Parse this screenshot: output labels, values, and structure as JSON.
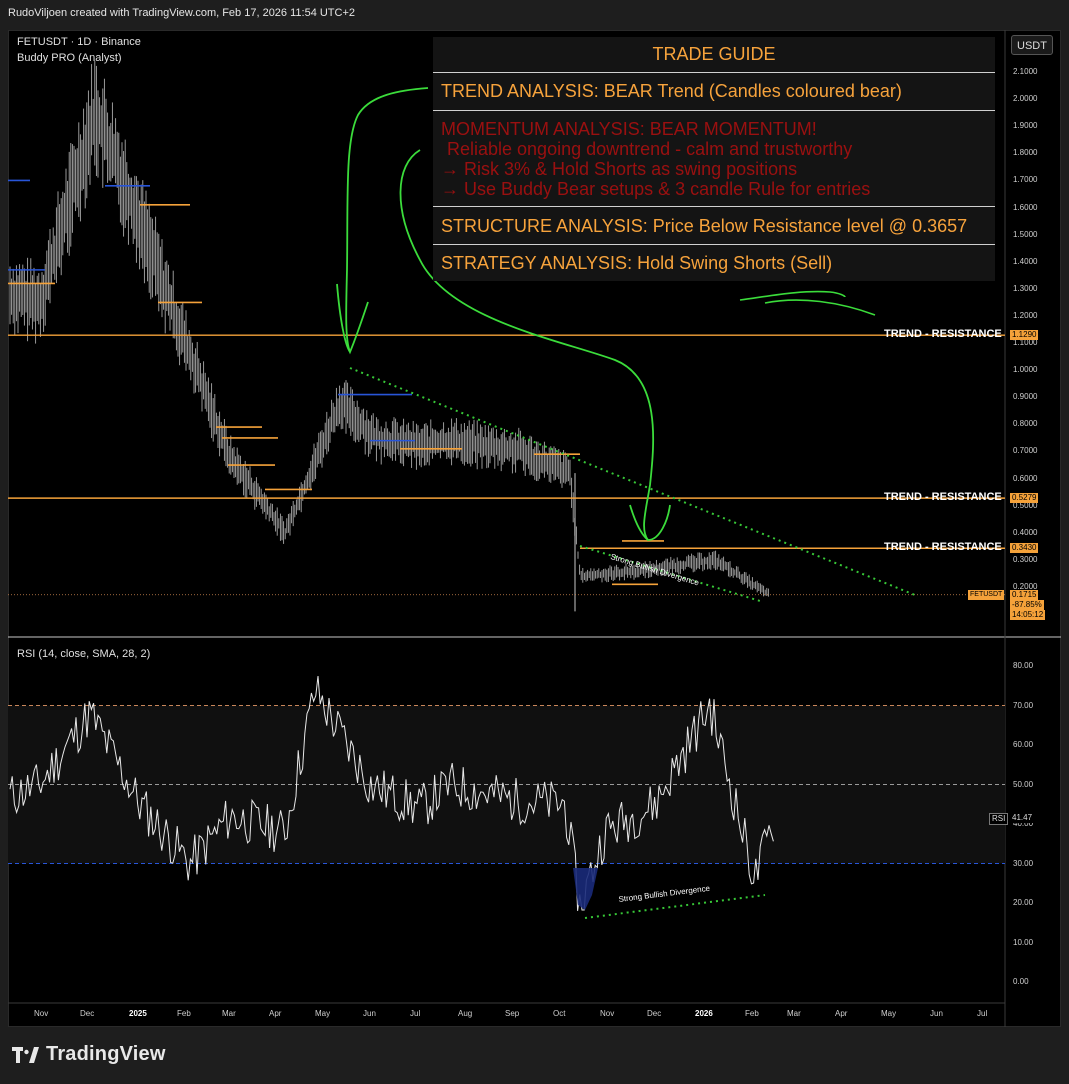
{
  "header": {
    "credit": "RudoViljoen created with TradingView.com, Feb 17, 2026 11:54 UTC+2"
  },
  "chart": {
    "symbol_line": "FETUSDT · 1D · Binance",
    "indicator_line": "Buddy PRO (Analyst)",
    "currency_button": "USDT"
  },
  "trade_guide": {
    "title": "TRADE GUIDE",
    "trend": "TREND ANALYSIS: BEAR Trend (Candles coloured bear)",
    "momentum_1": "MOMENTUM ANALYSIS: BEAR MOMENTUM!",
    "momentum_2": "Reliable ongoing downtrend - calm and trustworthy",
    "momentum_3": "→ Risk 3% & Hold Shorts as swing positions",
    "momentum_4": "→ Use Buddy Bear setups & 3 candle Rule for entries",
    "structure": "STRUCTURE ANALYSIS: Price Below Resistance level @ 0.3657",
    "strategy": "STRATEGY ANALYSIS: Hold Swing Shorts (Sell)"
  },
  "colors": {
    "resistance": "#f5a23a",
    "candle": "#c8c8c8",
    "blue_level": "#2855d8",
    "annotation_green": "#3bdc3b",
    "dotted_green": "#37c837"
  },
  "chart_data": [
    {
      "type": "line",
      "title": "FETUSDT · 1D · Binance",
      "x_ticks": [
        "Nov",
        "Dec",
        "2025",
        "Feb",
        "Mar",
        "Apr",
        "May",
        "Jun",
        "Jul",
        "Aug",
        "Sep",
        "Oct",
        "Nov",
        "Dec",
        "2026",
        "Feb",
        "Mar",
        "Apr",
        "May",
        "Jun",
        "Jul"
      ],
      "y_ticks": [
        "2.1000",
        "2.0000",
        "1.9000",
        "1.8000",
        "1.7000",
        "1.6000",
        "1.5000",
        "1.4000",
        "1.3000",
        "1.2000",
        "1.1000",
        "1.0000",
        "0.9000",
        "0.8000",
        "0.7000",
        "0.6000",
        "0.5000",
        "0.4000",
        "0.3000",
        "0.2000"
      ],
      "ylim": [
        0.12,
        2.22
      ],
      "resistance_levels": [
        {
          "label": "TREND - RESISTANCE",
          "value": 1.129,
          "tag": "1.1290"
        },
        {
          "label": "TREND - RESISTANCE",
          "value": 0.5279,
          "tag": "0.5279"
        },
        {
          "label": "TREND - RESISTANCE",
          "value": 0.343,
          "tag": "0.3430"
        }
      ],
      "last_price": {
        "symbol": "FETUSDT",
        "value": "0.1715",
        "change": "-87.85%",
        "countdown": "14:05:12"
      },
      "approx_close_path": [
        [
          "Oct",
          1.28
        ],
        [
          "Nov",
          1.25
        ],
        [
          "Dec",
          1.95
        ],
        [
          "2025",
          1.55
        ],
        [
          "Feb",
          1.15
        ],
        [
          "Mar",
          0.68
        ],
        [
          "Apr",
          0.4
        ],
        [
          "May",
          0.88
        ],
        [
          "Jun",
          0.75
        ],
        [
          "Jul",
          0.72
        ],
        [
          "Aug",
          0.74
        ],
        [
          "Sep",
          0.7
        ],
        [
          "Oct",
          0.62
        ],
        [
          "Nov",
          0.24
        ],
        [
          "Dec",
          0.26
        ],
        [
          "2026",
          0.3
        ],
        [
          "Feb",
          0.17
        ]
      ],
      "annotations": [
        "Strong Bullish Divergence"
      ]
    },
    {
      "type": "line",
      "title": "RSI (14, close, SMA, 28, 2)",
      "y_ticks": [
        "80.00",
        "70.00",
        "60.00",
        "50.00",
        "40.00",
        "30.00",
        "20.00",
        "10.00",
        "0.00"
      ],
      "ylim": [
        -3,
        85
      ],
      "bands": {
        "upper": 70,
        "middle": 50,
        "lower": 30
      },
      "last_value": {
        "label": "RSI",
        "value": "41.47"
      },
      "approx_path": [
        [
          "Oct",
          47
        ],
        [
          "Nov",
          50
        ],
        [
          "Dec",
          68
        ],
        [
          "2025",
          45
        ],
        [
          "Feb",
          30
        ],
        [
          "Mar",
          42
        ],
        [
          "Apr",
          38
        ],
        [
          "May",
          74
        ],
        [
          "Jun",
          50
        ],
        [
          "Jul",
          44
        ],
        [
          "Aug",
          50
        ],
        [
          "Sep",
          46
        ],
        [
          "Oct",
          45
        ],
        [
          "Oct",
          19
        ],
        [
          "Nov",
          38
        ],
        [
          "Dec",
          45
        ],
        [
          "2026",
          70
        ],
        [
          "Feb",
          26
        ],
        [
          "Feb",
          42
        ]
      ],
      "annotations": [
        "Strong Bullish Divergence"
      ]
    }
  ],
  "footer": {
    "brand": "TradingView"
  }
}
